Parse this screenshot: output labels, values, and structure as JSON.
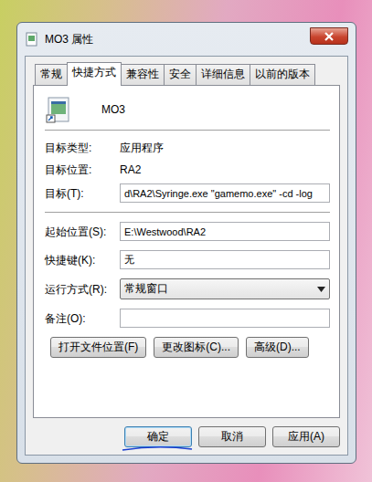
{
  "window": {
    "title": "MO3 属性"
  },
  "tabs": [
    {
      "label": "常规",
      "selected": false
    },
    {
      "label": "快捷方式",
      "selected": true
    },
    {
      "label": "兼容性",
      "selected": false
    },
    {
      "label": "安全",
      "selected": false
    },
    {
      "label": "详细信息",
      "selected": false
    },
    {
      "label": "以前的版本",
      "selected": false
    }
  ],
  "header": {
    "name": "MO3"
  },
  "info": [
    {
      "label": "目标类型:",
      "value": "应用程序"
    },
    {
      "label": "目标位置:",
      "value": "RA2"
    }
  ],
  "target": {
    "label": "目标(T):",
    "value": "d\\RA2\\Syringe.exe \"gamemo.exe\" -cd -log"
  },
  "fields": [
    {
      "label": "起始位置(S):",
      "value": "E:\\Westwood\\RA2",
      "kind": "input"
    },
    {
      "label": "快捷键(K):",
      "value": "无",
      "kind": "input"
    },
    {
      "label": "运行方式(R):",
      "value": "常规窗口",
      "kind": "select"
    },
    {
      "label": "备注(O):",
      "value": "",
      "kind": "input"
    }
  ],
  "actions": [
    "打开文件位置(F)",
    "更改图标(C)...",
    "高级(D)..."
  ],
  "buttons": [
    {
      "label": "确定",
      "default": true
    },
    {
      "label": "取消",
      "default": false
    },
    {
      "label": "应用(A)",
      "default": false
    }
  ]
}
